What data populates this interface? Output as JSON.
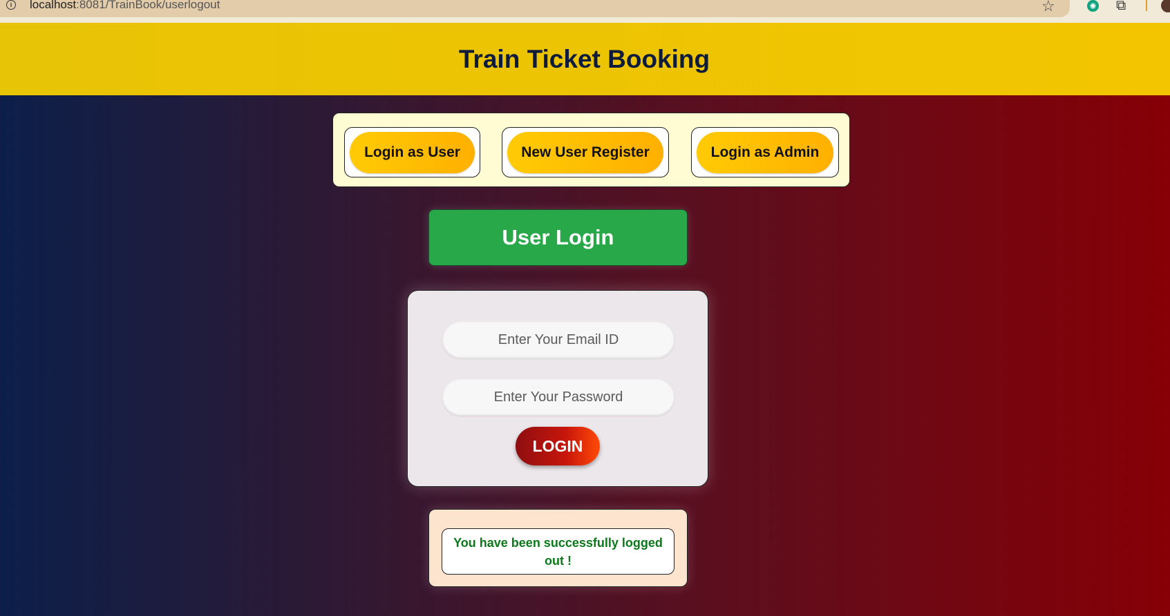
{
  "browser": {
    "url_host": "localhost",
    "url_rest": ":8081/TrainBook/userlogout"
  },
  "header": {
    "title": "Train Ticket Booking"
  },
  "nav": {
    "login_user": "Login as User",
    "register": "New User Register",
    "login_admin": "Login as Admin"
  },
  "login": {
    "banner": "User Login",
    "email_placeholder": "Enter Your Email ID",
    "password_placeholder": "Enter Your Password",
    "submit_label": "LOGIN"
  },
  "message": {
    "text": "You have been successfully logged out !"
  },
  "colors": {
    "header_bg": "#f2c500",
    "banner_bg": "#29a84a",
    "login_btn": "#c8160c",
    "message_text": "#0a7a1a"
  },
  "icons": [
    "info-icon",
    "star-icon",
    "openai-extension-icon",
    "extensions-icon",
    "profile-icon"
  ]
}
